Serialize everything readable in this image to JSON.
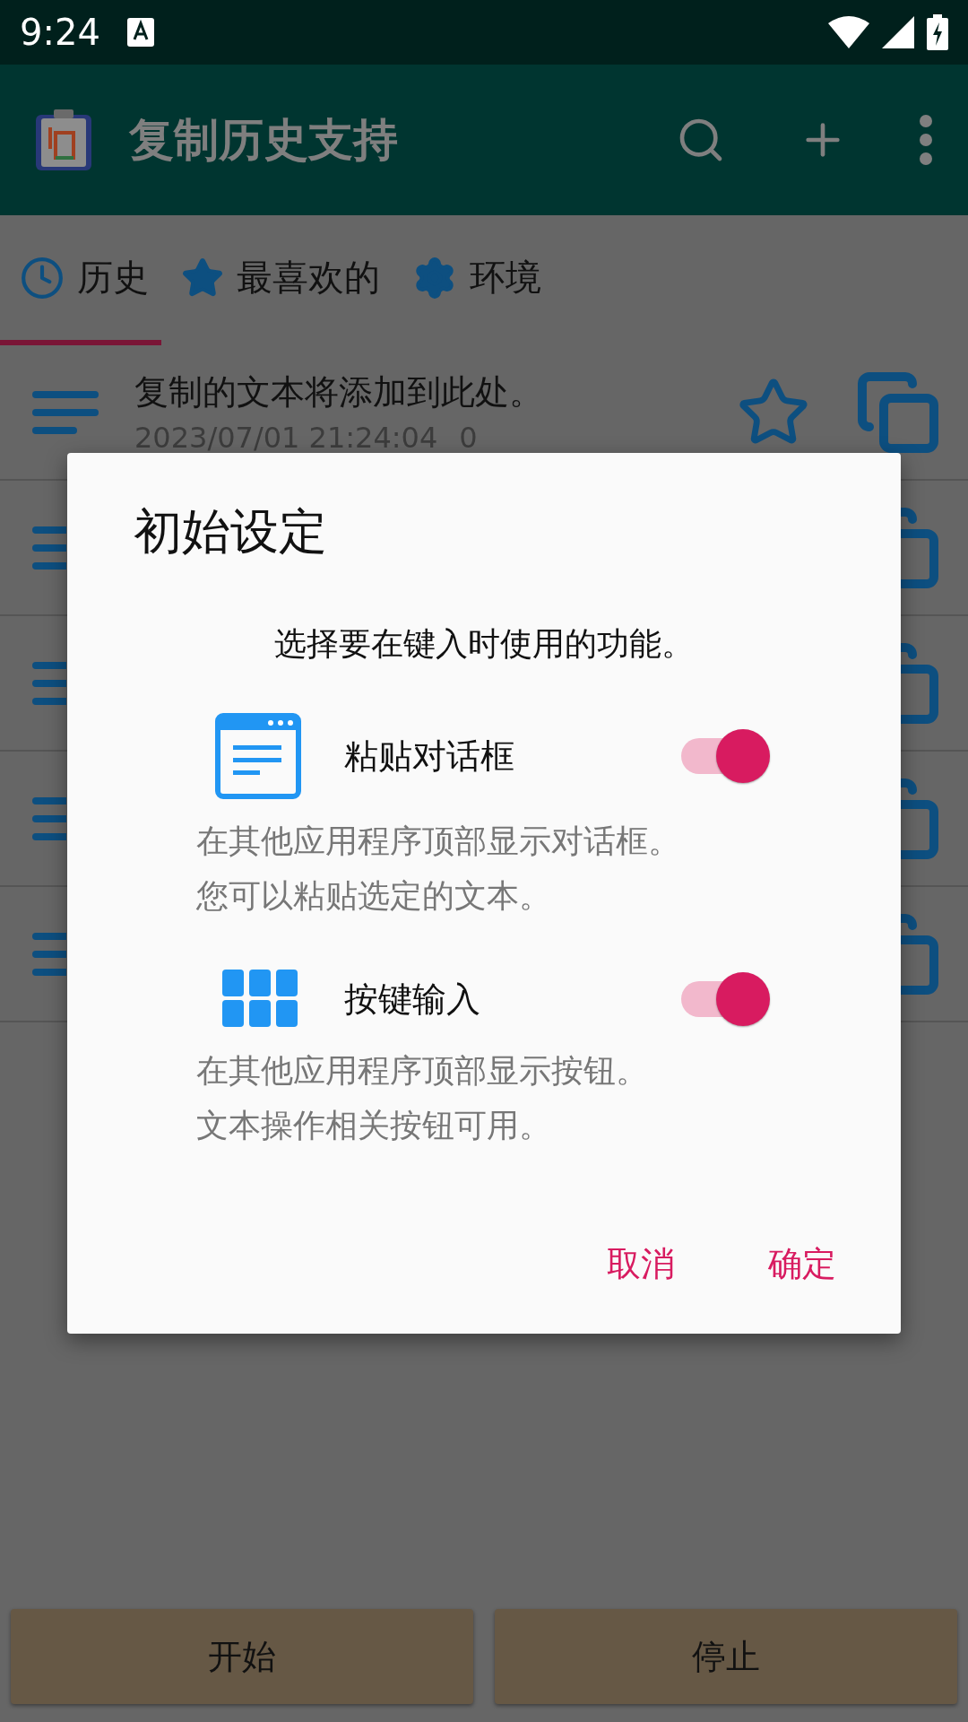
{
  "status_bar": {
    "time": "9:24"
  },
  "app_bar": {
    "title": "复制历史支持"
  },
  "tabs": [
    {
      "label": "历史",
      "selected": true
    },
    {
      "label": "最喜欢的",
      "selected": false
    },
    {
      "label": "环境",
      "selected": false
    }
  ],
  "rows": [
    {
      "kind": "entry",
      "text": "复制的文本将添加到此处。",
      "date": "2023/07/01 21:24:04",
      "count": "0",
      "favorite": false
    },
    {
      "kind": "covered"
    },
    {
      "kind": "covered"
    },
    {
      "kind": "covered"
    },
    {
      "kind": "covered"
    }
  ],
  "dialog": {
    "title": "初始设定",
    "subtitle": "选择要在键入时使用的功能。",
    "options": [
      {
        "label": "粘贴对话框",
        "on": true,
        "description": [
          "在其他应用程序顶部显示对话框。",
          "您可以粘贴选定的文本。"
        ]
      },
      {
        "label": "按键输入",
        "on": true,
        "description": [
          "在其他应用程序顶部显示按钮。",
          "文本操作相关按钮可用。"
        ]
      }
    ],
    "buttons": [
      "取消",
      "确定"
    ]
  },
  "bottom_buttons": [
    "开始",
    "停止"
  ]
}
